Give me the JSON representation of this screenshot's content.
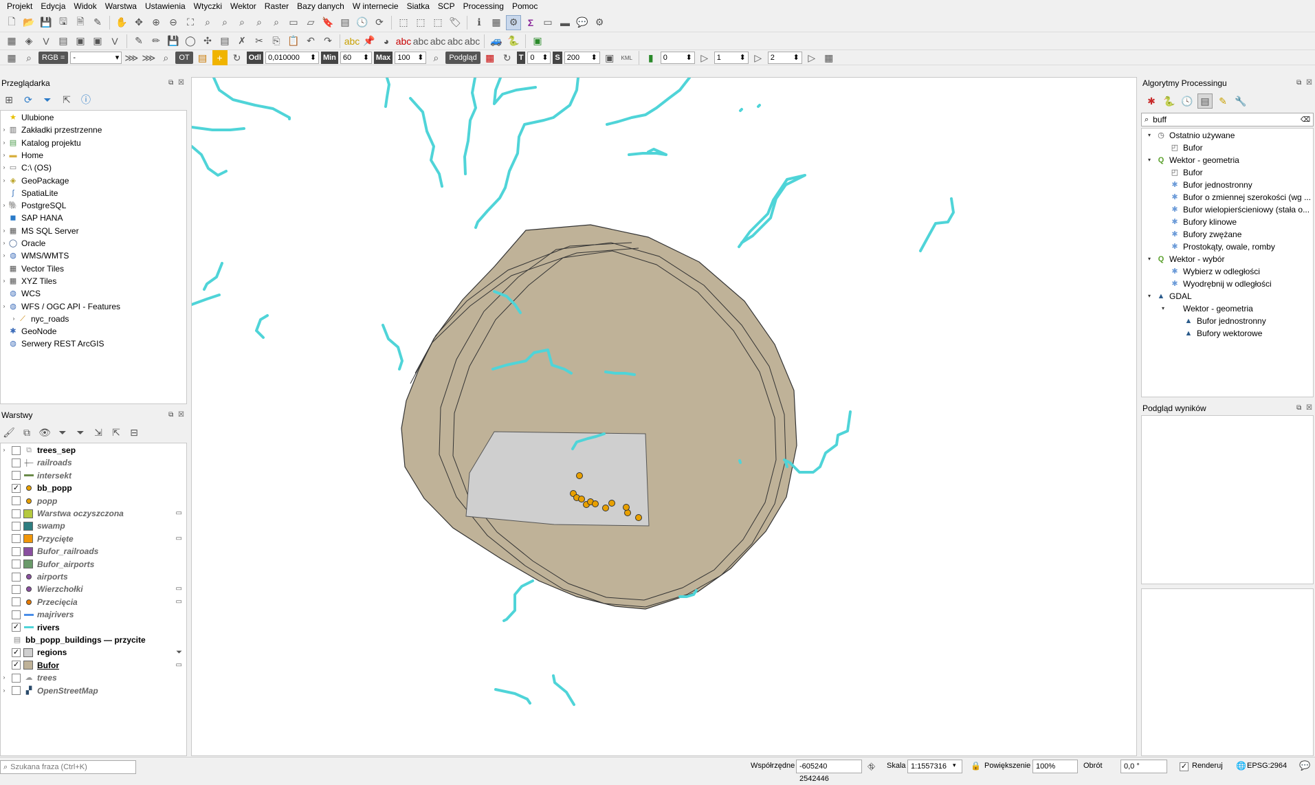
{
  "menu": [
    "Projekt",
    "Edycja",
    "Widok",
    "Warstwa",
    "Ustawienia",
    "Wtyczki",
    "Wektor",
    "Raster",
    "Bazy danych",
    "W internecie",
    "Siatka",
    "SCP",
    "Processing",
    "Pomoc"
  ],
  "scp_toolbar": {
    "rgb_label": "RGB =",
    "rgb_value": "-",
    "ot_label": "OT",
    "odl_label": "Odl",
    "odl_value": "0,010000",
    "min_label": "Min",
    "min_value": "60",
    "max_label": "Max",
    "max_value": "100",
    "podglad_label": "Podgląd",
    "t_label": "T",
    "t_value": "0",
    "s_label": "S",
    "s_value": "200",
    "band_value_1": "0",
    "band_value_2": "1",
    "band_value_3": "2"
  },
  "browser_panel": {
    "title": "Przeglądarka",
    "items": [
      {
        "label": "Ulubione",
        "icon": "star-icon",
        "expandable": false
      },
      {
        "label": "Zakładki przestrzenne",
        "icon": "bookmark-icon",
        "expandable": true
      },
      {
        "label": "Katalog projektu",
        "icon": "project-folder-icon",
        "expandable": true
      },
      {
        "label": "Home",
        "icon": "folder-icon",
        "expandable": true
      },
      {
        "label": "C:\\ (OS)",
        "icon": "drive-icon",
        "expandable": true
      },
      {
        "label": "GeoPackage",
        "icon": "geopackage-icon",
        "expandable": true
      },
      {
        "label": "SpatiaLite",
        "icon": "spatialite-icon",
        "expandable": false
      },
      {
        "label": "PostgreSQL",
        "icon": "postgresql-icon",
        "expandable": true
      },
      {
        "label": "SAP HANA",
        "icon": "saphana-icon",
        "expandable": false
      },
      {
        "label": "MS SQL Server",
        "icon": "mssql-icon",
        "expandable": true
      },
      {
        "label": "Oracle",
        "icon": "oracle-icon",
        "expandable": true
      },
      {
        "label": "WMS/WMTS",
        "icon": "wms-icon",
        "expandable": true
      },
      {
        "label": "Vector Tiles",
        "icon": "vector-tiles-icon",
        "expandable": false
      },
      {
        "label": "XYZ Tiles",
        "icon": "xyz-tiles-icon",
        "expandable": true
      },
      {
        "label": "WCS",
        "icon": "wcs-icon",
        "expandable": false
      },
      {
        "label": "WFS / OGC API - Features",
        "icon": "wfs-icon",
        "expandable": true
      },
      {
        "label": "nyc_roads",
        "icon": "line-layer-icon",
        "expandable": true,
        "child": true
      },
      {
        "label": "GeoNode",
        "icon": "geonode-icon",
        "expandable": false
      },
      {
        "label": "Serwery REST ArcGIS",
        "icon": "arcgis-icon",
        "expandable": false
      }
    ]
  },
  "layers_panel": {
    "title": "Warstwy",
    "layers": [
      {
        "name": "trees_sep",
        "checked": false,
        "visible": true,
        "symbol": "group",
        "color": "#999999"
      },
      {
        "name": "railroads",
        "checked": false,
        "visible": false,
        "symbol": "rail",
        "color": "#555555"
      },
      {
        "name": "intersekt",
        "checked": false,
        "visible": false,
        "symbol": "line",
        "color": "#6a8a4a"
      },
      {
        "name": "bb_popp",
        "checked": true,
        "visible": true,
        "symbol": "point",
        "color": "#e8a000"
      },
      {
        "name": "popp",
        "checked": false,
        "visible": false,
        "symbol": "point",
        "color": "#e8a000"
      },
      {
        "name": "Warstwa oczyszczona",
        "checked": false,
        "visible": false,
        "symbol": "fill",
        "color": "#b5c93f"
      },
      {
        "name": "swamp",
        "checked": false,
        "visible": false,
        "symbol": "fill",
        "color": "#2e7d80"
      },
      {
        "name": "Przycięte",
        "checked": false,
        "visible": false,
        "symbol": "fill",
        "color": "#f0960a"
      },
      {
        "name": "Bufor_railroads",
        "checked": false,
        "visible": false,
        "symbol": "fill",
        "color": "#8a4fa0"
      },
      {
        "name": "Bufor_airports",
        "checked": false,
        "visible": false,
        "symbol": "fill",
        "color": "#6a9a6a"
      },
      {
        "name": "airports",
        "checked": false,
        "visible": false,
        "symbol": "point",
        "color": "#8a4fa0"
      },
      {
        "name": "Wierzchołki",
        "checked": false,
        "visible": false,
        "symbol": "point",
        "color": "#8a4fa0"
      },
      {
        "name": "Przecięcia",
        "checked": false,
        "visible": false,
        "symbol": "point",
        "color": "#e87a00"
      },
      {
        "name": "majrivers",
        "checked": false,
        "visible": false,
        "symbol": "line",
        "color": "#4a8ee8"
      },
      {
        "name": "rivers",
        "checked": true,
        "visible": true,
        "symbol": "line",
        "color": "#4fd4d8"
      },
      {
        "name": "bb_popp_buildings — przycite",
        "checked": null,
        "visible": true,
        "symbol": "table",
        "color": "#888888"
      },
      {
        "name": "regions",
        "checked": true,
        "visible": true,
        "symbol": "fill",
        "color": "#cfcfcf"
      },
      {
        "name": "Bufor",
        "checked": true,
        "visible": true,
        "symbol": "fill",
        "color": "#bfb298"
      },
      {
        "name": "trees",
        "checked": false,
        "visible": false,
        "symbol": "fill-outline",
        "color": "#999999"
      },
      {
        "name": "OpenStreetMap",
        "checked": false,
        "visible": false,
        "symbol": "raster",
        "color": "#333333"
      }
    ]
  },
  "search": {
    "placeholder": "Szukana fraza (Ctrl+K)"
  },
  "processing_panel": {
    "title": "Algorytmy Processingu",
    "search_value": "buff",
    "tree": [
      {
        "label": "Ostatnio używane",
        "level": 0,
        "icon": "clock-icon",
        "expanded": true
      },
      {
        "label": "Bufor",
        "level": 1,
        "icon": "buffer-icon"
      },
      {
        "label": "Wektor - geometria",
        "level": 0,
        "icon": "qgis-icon",
        "expanded": true
      },
      {
        "label": "Bufor",
        "level": 1,
        "icon": "buffer-icon"
      },
      {
        "label": "Bufor jednostronny",
        "level": 1,
        "icon": "gear-icon"
      },
      {
        "label": "Bufor o zmiennej szerokości (wg ...",
        "level": 1,
        "icon": "gear-icon"
      },
      {
        "label": "Bufor wielopierścieniowy (stała o...",
        "level": 1,
        "icon": "gear-icon"
      },
      {
        "label": "Bufory klinowe",
        "level": 1,
        "icon": "gear-icon"
      },
      {
        "label": "Bufory zwężane",
        "level": 1,
        "icon": "gear-icon"
      },
      {
        "label": "Prostokąty, owale, romby",
        "level": 1,
        "icon": "gear-icon"
      },
      {
        "label": "Wektor - wybór",
        "level": 0,
        "icon": "qgis-icon",
        "expanded": true
      },
      {
        "label": "Wybierz w odległości",
        "level": 1,
        "icon": "gear-icon"
      },
      {
        "label": "Wyodrębnij w odległości",
        "level": 1,
        "icon": "gear-icon"
      },
      {
        "label": "GDAL",
        "level": 0,
        "icon": "gdal-icon",
        "expanded": true
      },
      {
        "label": "Wektor - geometria",
        "level": 1,
        "icon": "none",
        "expanded": true
      },
      {
        "label": "Bufor jednostronny",
        "level": 2,
        "icon": "gdal-icon"
      },
      {
        "label": "Bufory wektorowe",
        "level": 2,
        "icon": "gdal-icon"
      }
    ]
  },
  "results_panel": {
    "title": "Podgląd wyników"
  },
  "status": {
    "coord_label": "Współrzędne",
    "coord_value": "-605240 2542446",
    "scale_label": "Skala",
    "scale_value": "1:1557316",
    "zoom_label": "Powiększenie",
    "zoom_value": "100%",
    "rotation_label": "Obrót",
    "rotation_value": "0,0 °",
    "render_label": "Renderuj",
    "crs_label": "EPSG:2964"
  },
  "colors": {
    "buffer_fill": "#bfb298",
    "river": "#4fd4d8",
    "region_fill": "#cfcfcf",
    "points": "#e8a000"
  }
}
